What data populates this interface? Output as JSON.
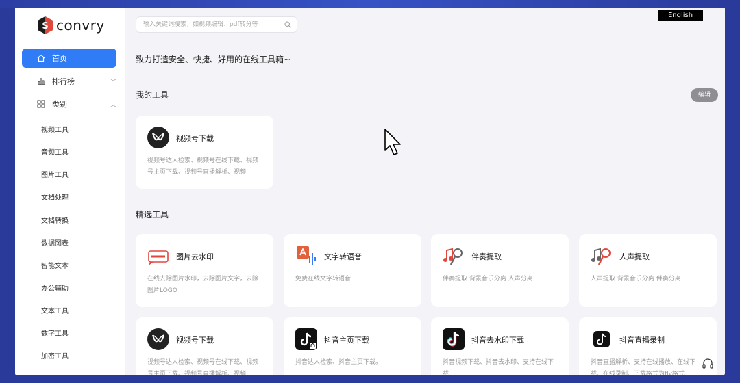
{
  "brand": {
    "logo_text": "convry"
  },
  "lang_button": "English",
  "search": {
    "placeholder": "输入关键词搜索，如视频编辑、pdf转分等"
  },
  "sidebar": {
    "home": "首页",
    "ranking": "排行榜",
    "categories": "类别",
    "sub_items": [
      "视频工具",
      "音频工具",
      "图片工具",
      "文档处理",
      "文档转换",
      "数据图表",
      "智能文本",
      "办公辅助",
      "文本工具",
      "数字工具",
      "加密工具"
    ]
  },
  "tagline": "致力打造安全、快捷、好用的在线工具箱~",
  "my_tools": {
    "title": "我的工具",
    "edit_label": "编辑",
    "cards": [
      {
        "name": "视频号下载",
        "desc": "视频号达人检索、视频号在线下载、视频号主页下载、视频号直播解析、视频",
        "icon": "wechat-channels-icon"
      }
    ]
  },
  "featured": {
    "title": "精选工具",
    "cards": [
      {
        "name": "图片去水印",
        "desc": "在线去除图片水印，去除图片文字，去除图片LOGO",
        "icon": "watermark-icon"
      },
      {
        "name": "文字转语音",
        "desc": "免费在线文字转语音",
        "icon": "text-to-speech-icon"
      },
      {
        "name": "伴奏提取",
        "desc": "伴奏提取 背景音乐分离 人声分离",
        "icon": "accompaniment-icon"
      },
      {
        "name": "人声提取",
        "desc": "人声提取 背景音乐分离 伴奏分离",
        "icon": "vocal-icon"
      },
      {
        "name": "视频号下载",
        "desc": "视频号达人检索、视频号在线下载、视频号主页下载、视频号直播解析、视频",
        "icon": "wechat-channels-icon"
      },
      {
        "name": "抖音主页下载",
        "desc": "抖音达人检索、抖音主页下载。",
        "icon": "douyin-home-icon"
      },
      {
        "name": "抖音去水印下载",
        "desc": "抖音视频下载、抖音去水印、支持在线下载",
        "icon": "douyin-icon"
      },
      {
        "name": "抖音直播录制",
        "desc": "抖音直播解析、支持在线播放、在线下载、在线录制、下载格式为flv格式",
        "icon": "douyin-live-icon"
      }
    ]
  },
  "colors": {
    "accent": "#2f7cf6",
    "page_bg": "#f4f4f8",
    "card_bg": "#ffffff"
  }
}
